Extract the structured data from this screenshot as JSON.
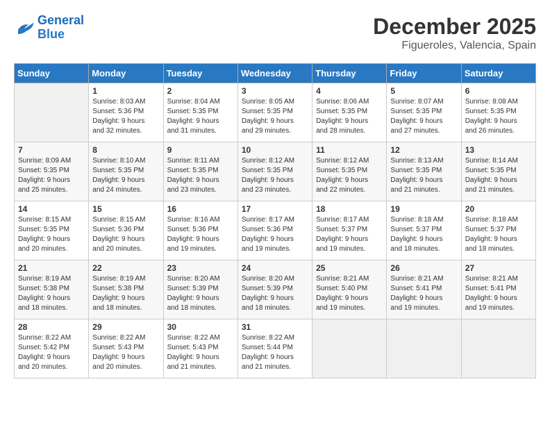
{
  "logo": {
    "line1": "General",
    "line2": "Blue"
  },
  "title": "December 2025",
  "location": "Figueroles, Valencia, Spain",
  "days_header": [
    "Sunday",
    "Monday",
    "Tuesday",
    "Wednesday",
    "Thursday",
    "Friday",
    "Saturday"
  ],
  "weeks": [
    [
      {
        "num": "",
        "info": ""
      },
      {
        "num": "1",
        "info": "Sunrise: 8:03 AM\nSunset: 5:36 PM\nDaylight: 9 hours\nand 32 minutes."
      },
      {
        "num": "2",
        "info": "Sunrise: 8:04 AM\nSunset: 5:35 PM\nDaylight: 9 hours\nand 31 minutes."
      },
      {
        "num": "3",
        "info": "Sunrise: 8:05 AM\nSunset: 5:35 PM\nDaylight: 9 hours\nand 29 minutes."
      },
      {
        "num": "4",
        "info": "Sunrise: 8:06 AM\nSunset: 5:35 PM\nDaylight: 9 hours\nand 28 minutes."
      },
      {
        "num": "5",
        "info": "Sunrise: 8:07 AM\nSunset: 5:35 PM\nDaylight: 9 hours\nand 27 minutes."
      },
      {
        "num": "6",
        "info": "Sunrise: 8:08 AM\nSunset: 5:35 PM\nDaylight: 9 hours\nand 26 minutes."
      }
    ],
    [
      {
        "num": "7",
        "info": "Sunrise: 8:09 AM\nSunset: 5:35 PM\nDaylight: 9 hours\nand 25 minutes."
      },
      {
        "num": "8",
        "info": "Sunrise: 8:10 AM\nSunset: 5:35 PM\nDaylight: 9 hours\nand 24 minutes."
      },
      {
        "num": "9",
        "info": "Sunrise: 8:11 AM\nSunset: 5:35 PM\nDaylight: 9 hours\nand 23 minutes."
      },
      {
        "num": "10",
        "info": "Sunrise: 8:12 AM\nSunset: 5:35 PM\nDaylight: 9 hours\nand 23 minutes."
      },
      {
        "num": "11",
        "info": "Sunrise: 8:12 AM\nSunset: 5:35 PM\nDaylight: 9 hours\nand 22 minutes."
      },
      {
        "num": "12",
        "info": "Sunrise: 8:13 AM\nSunset: 5:35 PM\nDaylight: 9 hours\nand 21 minutes."
      },
      {
        "num": "13",
        "info": "Sunrise: 8:14 AM\nSunset: 5:35 PM\nDaylight: 9 hours\nand 21 minutes."
      }
    ],
    [
      {
        "num": "14",
        "info": "Sunrise: 8:15 AM\nSunset: 5:35 PM\nDaylight: 9 hours\nand 20 minutes."
      },
      {
        "num": "15",
        "info": "Sunrise: 8:15 AM\nSunset: 5:36 PM\nDaylight: 9 hours\nand 20 minutes."
      },
      {
        "num": "16",
        "info": "Sunrise: 8:16 AM\nSunset: 5:36 PM\nDaylight: 9 hours\nand 19 minutes."
      },
      {
        "num": "17",
        "info": "Sunrise: 8:17 AM\nSunset: 5:36 PM\nDaylight: 9 hours\nand 19 minutes."
      },
      {
        "num": "18",
        "info": "Sunrise: 8:17 AM\nSunset: 5:37 PM\nDaylight: 9 hours\nand 19 minutes."
      },
      {
        "num": "19",
        "info": "Sunrise: 8:18 AM\nSunset: 5:37 PM\nDaylight: 9 hours\nand 18 minutes."
      },
      {
        "num": "20",
        "info": "Sunrise: 8:18 AM\nSunset: 5:37 PM\nDaylight: 9 hours\nand 18 minutes."
      }
    ],
    [
      {
        "num": "21",
        "info": "Sunrise: 8:19 AM\nSunset: 5:38 PM\nDaylight: 9 hours\nand 18 minutes."
      },
      {
        "num": "22",
        "info": "Sunrise: 8:19 AM\nSunset: 5:38 PM\nDaylight: 9 hours\nand 18 minutes."
      },
      {
        "num": "23",
        "info": "Sunrise: 8:20 AM\nSunset: 5:39 PM\nDaylight: 9 hours\nand 18 minutes."
      },
      {
        "num": "24",
        "info": "Sunrise: 8:20 AM\nSunset: 5:39 PM\nDaylight: 9 hours\nand 18 minutes."
      },
      {
        "num": "25",
        "info": "Sunrise: 8:21 AM\nSunset: 5:40 PM\nDaylight: 9 hours\nand 19 minutes."
      },
      {
        "num": "26",
        "info": "Sunrise: 8:21 AM\nSunset: 5:41 PM\nDaylight: 9 hours\nand 19 minutes."
      },
      {
        "num": "27",
        "info": "Sunrise: 8:21 AM\nSunset: 5:41 PM\nDaylight: 9 hours\nand 19 minutes."
      }
    ],
    [
      {
        "num": "28",
        "info": "Sunrise: 8:22 AM\nSunset: 5:42 PM\nDaylight: 9 hours\nand 20 minutes."
      },
      {
        "num": "29",
        "info": "Sunrise: 8:22 AM\nSunset: 5:43 PM\nDaylight: 9 hours\nand 20 minutes."
      },
      {
        "num": "30",
        "info": "Sunrise: 8:22 AM\nSunset: 5:43 PM\nDaylight: 9 hours\nand 21 minutes."
      },
      {
        "num": "31",
        "info": "Sunrise: 8:22 AM\nSunset: 5:44 PM\nDaylight: 9 hours\nand 21 minutes."
      },
      {
        "num": "",
        "info": ""
      },
      {
        "num": "",
        "info": ""
      },
      {
        "num": "",
        "info": ""
      }
    ]
  ]
}
